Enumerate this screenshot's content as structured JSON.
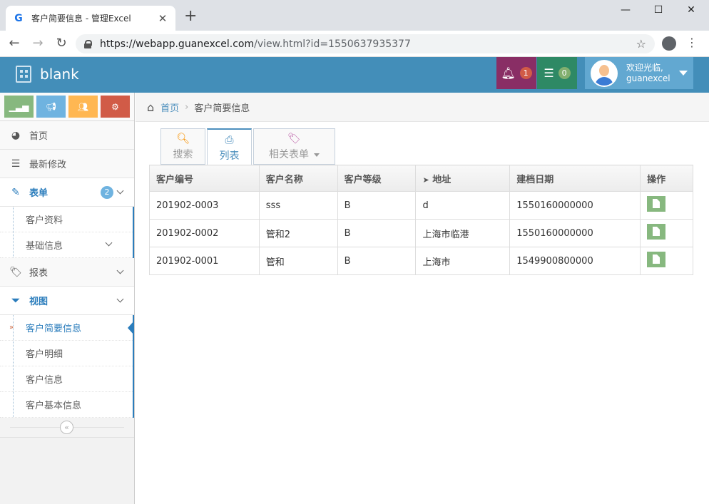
{
  "browser": {
    "tab_title": "客户简要信息 - 管理Excel",
    "tab_favicon": "G",
    "url_host": "https://webapp.guanexcel.com",
    "url_path": "/view.html?id=1550637935377",
    "controls": {
      "minimize": "—",
      "maximize": "☐",
      "close": "✕"
    }
  },
  "header": {
    "brand": "blank",
    "notifications_count": "1",
    "messages_count": "0",
    "welcome": "欢迎光临,",
    "username": "guanexcel"
  },
  "sidebar": {
    "items": [
      {
        "label": "首页",
        "icon": "dashboard-icon"
      },
      {
        "label": "最新修改",
        "icon": "list-icon"
      },
      {
        "label": "表单",
        "icon": "edit-icon",
        "badge": "2"
      },
      {
        "label": "报表",
        "icon": "tag-icon"
      },
      {
        "label": "视图",
        "icon": "filter-icon"
      }
    ],
    "form_sub": [
      "客户资料",
      "基础信息"
    ],
    "view_sub": [
      "客户简要信息",
      "客户明细",
      "客户信息",
      "客户基本信息"
    ]
  },
  "breadcrumb": {
    "home": "首页",
    "current": "客户简要信息"
  },
  "tabs": {
    "search": "搜索",
    "list": "列表",
    "related": "相关表单"
  },
  "table": {
    "headers": [
      "客户编号",
      "客户名称",
      "客户等级",
      "地址",
      "建档日期",
      "操作"
    ],
    "rows": [
      [
        "201902-0003",
        "sss",
        "B",
        "d",
        "1550160000000"
      ],
      [
        "201902-0002",
        "管和2",
        "B",
        "上海市临港",
        "1550160000000"
      ],
      [
        "201902-0001",
        "管和",
        "B",
        "上海市",
        "1549900800000"
      ]
    ]
  }
}
